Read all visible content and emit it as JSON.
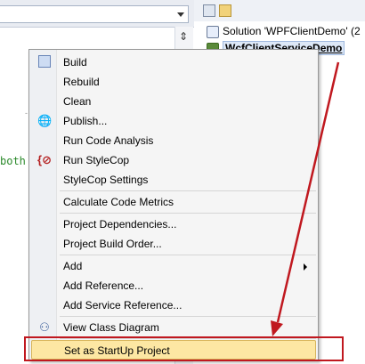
{
  "editor": {
    "code_fragment": "both",
    "split_icon": "split-view-icon"
  },
  "solution_explorer": {
    "toolbar_icons": [
      "properties-icon",
      "show-all-files-icon"
    ],
    "solution_label": "Solution 'WPFClientDemo' (2",
    "project_label": "WcfClientServiceDemo"
  },
  "context_menu": {
    "items": [
      {
        "label": "Build",
        "icon": "build-icon"
      },
      {
        "label": "Rebuild"
      },
      {
        "label": "Clean"
      },
      {
        "label": "Publish...",
        "icon": "publish-icon"
      },
      {
        "label": "Run Code Analysis"
      },
      {
        "label": "Run StyleCop",
        "icon": "stylecop-icon"
      },
      {
        "label": "StyleCop Settings"
      },
      {
        "label": "Calculate Code Metrics"
      },
      {
        "label": "Project Dependencies..."
      },
      {
        "label": "Project Build Order..."
      },
      {
        "label": "Add",
        "submenu": true
      },
      {
        "label": "Add Reference..."
      },
      {
        "label": "Add Service Reference..."
      },
      {
        "label": "View Class Diagram",
        "icon": "class-diagram-icon"
      },
      {
        "label": "Set as StartUp Project",
        "highlighted": true
      }
    ]
  },
  "annotation": {
    "color": "#c0181f"
  }
}
